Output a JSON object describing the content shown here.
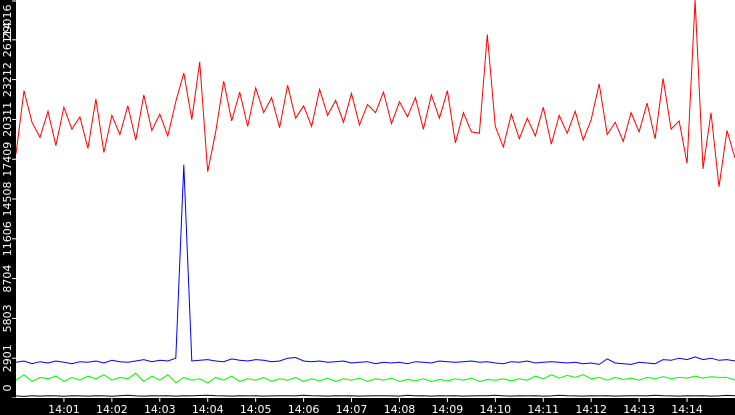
{
  "chart_data": {
    "type": "line",
    "title": "",
    "xlabel": "",
    "ylabel": "",
    "xlim_minutes": [
      0,
      15
    ],
    "ylim": [
      0,
      29016
    ],
    "grid": false,
    "legend": "none",
    "y_ticks": [
      0,
      2901,
      5803,
      8704,
      11606,
      14508,
      17409,
      20311,
      23212,
      26114,
      29016
    ],
    "x_ticks": [
      {
        "label": "14:01",
        "minute": 1
      },
      {
        "label": "14:02",
        "minute": 2
      },
      {
        "label": "14:03",
        "minute": 3
      },
      {
        "label": "14:04",
        "minute": 4
      },
      {
        "label": "14:05",
        "minute": 5
      },
      {
        "label": "14:06",
        "minute": 6
      },
      {
        "label": "14:07",
        "minute": 7
      },
      {
        "label": "14:08",
        "minute": 8
      },
      {
        "label": "14:09",
        "minute": 9
      },
      {
        "label": "14:10",
        "minute": 10
      },
      {
        "label": "14:11",
        "minute": 11
      },
      {
        "label": "14:12",
        "minute": 12
      },
      {
        "label": "14:13",
        "minute": 13
      },
      {
        "label": "14:14",
        "minute": 14
      }
    ],
    "series": [
      {
        "name": "red",
        "color": "#ff0000",
        "values": [
          17800,
          22400,
          20100,
          19000,
          20900,
          18400,
          21200,
          19600,
          20500,
          18200,
          21800,
          17900,
          20600,
          19200,
          21300,
          18800,
          22100,
          19500,
          20700,
          19100,
          21600,
          23700,
          20300,
          24500,
          16500,
          19400,
          23100,
          20200,
          22300,
          19800,
          22600,
          20800,
          21900,
          19700,
          22800,
          20400,
          21300,
          19800,
          22500,
          20600,
          21700,
          20100,
          22200,
          19900,
          21400,
          20800,
          22300,
          20000,
          21600,
          20500,
          21900,
          19600,
          22100,
          20400,
          22400,
          18600,
          20800,
          19400,
          19300,
          26500,
          19800,
          18300,
          20700,
          18900,
          20400,
          19100,
          21200,
          18500,
          20600,
          19300,
          20900,
          18800,
          20300,
          22900,
          19200,
          20100,
          18700,
          20800,
          19400,
          21500,
          18900,
          23300,
          19600,
          20200,
          17100,
          29000,
          16700,
          20800,
          15400,
          19500,
          17500
        ]
      },
      {
        "name": "blue",
        "color": "#0000ff",
        "values": [
          2600,
          2700,
          2500,
          2650,
          2550,
          2700,
          2600,
          2500,
          2650,
          2600,
          2700,
          2550,
          2750,
          2650,
          2600,
          2700,
          2800,
          2650,
          2750,
          2700,
          2900,
          17000,
          2700,
          2750,
          2800,
          2700,
          2650,
          2850,
          2750,
          2700,
          2800,
          2750,
          2650,
          2700,
          2900,
          2950,
          2700,
          2650,
          2700,
          2600,
          2650,
          2700,
          2550,
          2600,
          2650,
          2500,
          2600,
          2550,
          2600,
          2500,
          2650,
          2600,
          2550,
          2700,
          2650,
          2600,
          2650,
          2700,
          2600,
          2650,
          2550,
          2500,
          2650,
          2600,
          2700,
          2550,
          2600,
          2650,
          2600,
          2550,
          2600,
          2500,
          2550,
          2450,
          2850,
          2550,
          2500,
          2450,
          2600,
          2550,
          2500,
          2800,
          2750,
          2900,
          2800,
          3000,
          2800,
          2900,
          2750,
          2800,
          2700
        ]
      },
      {
        "name": "green",
        "color": "#00ff00",
        "values": [
          1300,
          1700,
          1200,
          1500,
          1400,
          1600,
          1200,
          1500,
          1300,
          1600,
          1400,
          1700,
          1300,
          1500,
          1400,
          1800,
          1200,
          1600,
          1300,
          1700,
          1100,
          1500,
          1300,
          1400,
          1100,
          1500,
          1300,
          1600,
          1200,
          1400,
          1300,
          1500,
          1200,
          1400,
          1300,
          1500,
          1200,
          1400,
          1250,
          1450,
          1200,
          1400,
          1300,
          1450,
          1200,
          1400,
          1300,
          1450,
          1200,
          1350,
          1250,
          1400,
          1200,
          1350,
          1250,
          1400,
          1300,
          1450,
          1200,
          1350,
          1300,
          1400,
          1250,
          1400,
          1300,
          1600,
          1400,
          1700,
          1450,
          1650,
          1500,
          1700,
          1400,
          1500,
          1300,
          1500,
          1350,
          1450,
          1300,
          1500,
          1400,
          1550,
          1400,
          1500,
          1450,
          1600,
          1450,
          1550,
          1500,
          1500,
          1300
        ]
      },
      {
        "name": "black",
        "color": "#000000",
        "values": [
          150,
          120,
          160,
          140,
          170,
          150,
          130,
          160,
          150,
          140,
          170,
          150,
          130,
          160,
          200,
          150,
          140,
          160,
          150,
          170,
          140,
          160,
          150,
          180,
          200,
          160,
          150,
          140,
          170,
          150,
          160,
          140,
          150,
          170,
          160,
          150,
          200,
          160,
          150,
          140,
          170,
          150,
          160,
          140,
          150,
          170,
          160,
          150,
          140,
          200,
          150,
          160,
          140,
          170,
          150,
          160,
          140,
          150,
          170,
          160,
          200,
          150,
          140,
          170,
          150,
          160,
          140,
          150,
          200,
          160,
          150,
          140,
          170,
          150,
          160,
          140,
          150,
          170,
          160,
          150,
          200,
          160,
          150,
          140,
          170,
          150,
          160,
          140,
          150,
          190,
          170
        ]
      }
    ]
  }
}
